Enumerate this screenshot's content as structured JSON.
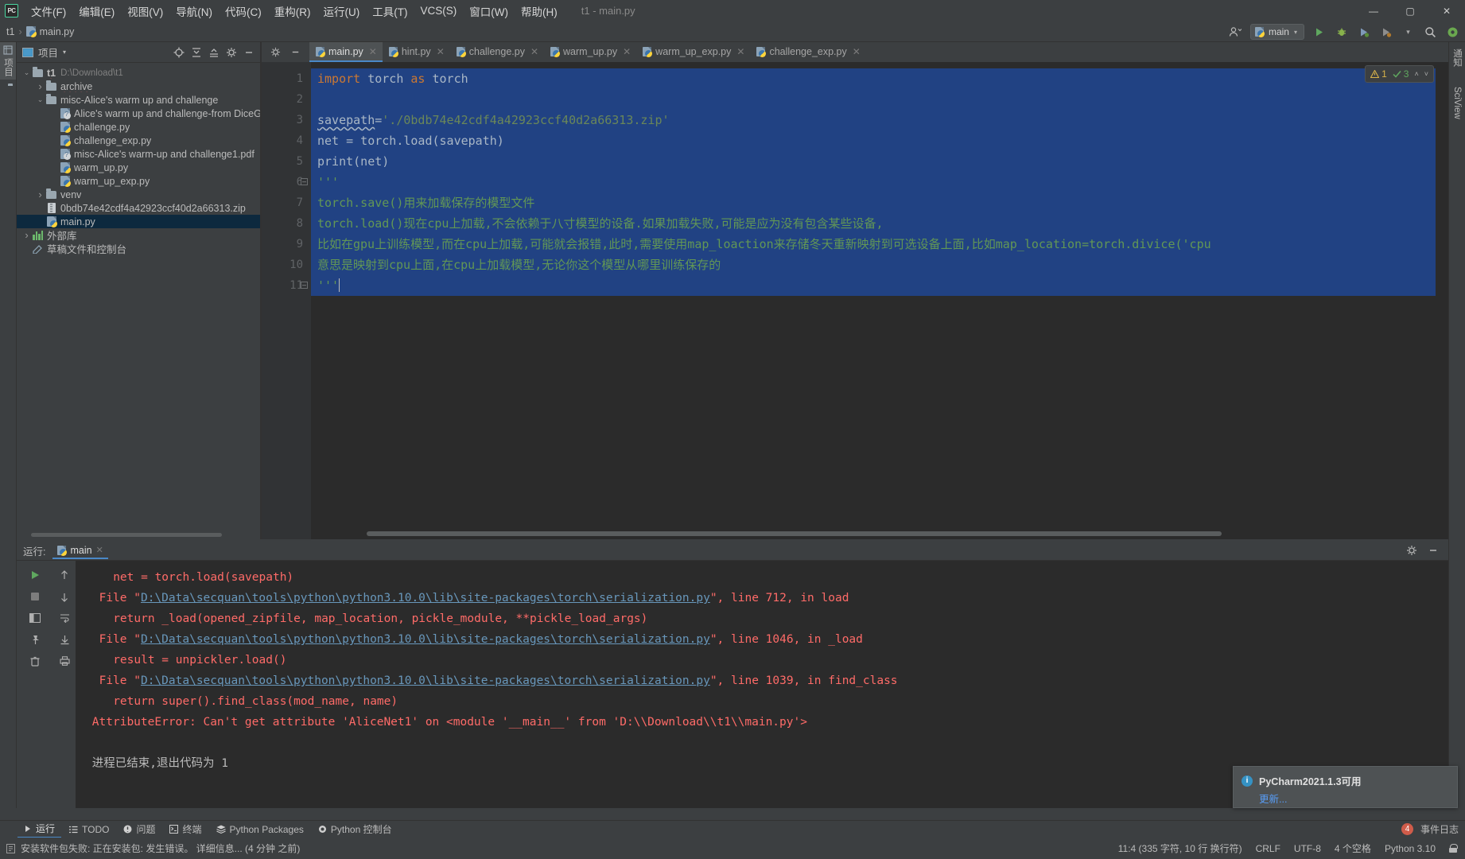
{
  "window": {
    "title": "t1 - main.py",
    "app_logo": "PC"
  },
  "menubar": {
    "items": [
      {
        "label": "文件(F)"
      },
      {
        "label": "编辑(E)"
      },
      {
        "label": "视图(V)"
      },
      {
        "label": "导航(N)"
      },
      {
        "label": "代码(C)"
      },
      {
        "label": "重构(R)"
      },
      {
        "label": "运行(U)"
      },
      {
        "label": "工具(T)"
      },
      {
        "label": "VCS(S)"
      },
      {
        "label": "窗口(W)"
      },
      {
        "label": "帮助(H)"
      }
    ],
    "controls": {
      "minimize": "—",
      "maximize": "▢",
      "close": "✕"
    }
  },
  "navbar": {
    "project": "t1",
    "file": "main.py",
    "run_config": "main",
    "run_icon": "run-icon",
    "debug_icon": "debug-icon",
    "coverage_icon": "coverage-icon",
    "profile_icon": "profile-icon",
    "more_icon": "chevron-down-icon",
    "search_icon": "search-icon",
    "account_icon": "account-icon",
    "settings_icon": "gear-icon"
  },
  "left_rail": {
    "items": [
      {
        "label": "项目",
        "name": "rail-project"
      },
      {
        "label": "",
        "name": "rail-structure"
      }
    ]
  },
  "right_rail": {
    "items": [
      {
        "label": "通知",
        "name": "rail-notifications"
      },
      {
        "label": "SciView",
        "name": "rail-sciview"
      }
    ]
  },
  "project_panel": {
    "title": "项目",
    "dropdown": "▾",
    "actions": [
      "locate-icon",
      "expand-all-icon",
      "collapse-all-icon",
      "gear-icon",
      "hide-icon"
    ],
    "tree": [
      {
        "indent": 0,
        "arrow": "v",
        "icon": "folder-icon",
        "label": "t1",
        "sub": "D:\\Download\\t1",
        "bold": true,
        "wavy": true,
        "selected": false
      },
      {
        "indent": 1,
        "arrow": ">",
        "icon": "folder-icon",
        "label": "archive",
        "sub": "",
        "wavy": true,
        "selected": false
      },
      {
        "indent": 1,
        "arrow": "v",
        "icon": "folder-icon",
        "label": "misc-Alice's warm up and challenge",
        "sub": "",
        "selected": false
      },
      {
        "indent": 2,
        "arrow": "",
        "icon": "file-unknown-icon",
        "label": "Alice's warm up and challenge-from DiceGuesser",
        "sub": "",
        "selected": false
      },
      {
        "indent": 2,
        "arrow": "",
        "icon": "python-file-icon",
        "label": "challenge.py",
        "sub": "",
        "selected": false
      },
      {
        "indent": 2,
        "arrow": "",
        "icon": "python-file-icon",
        "label": "challenge_exp.py",
        "sub": "",
        "selected": false
      },
      {
        "indent": 2,
        "arrow": "",
        "icon": "file-unknown-icon",
        "label": "misc-Alice's warm-up and challenge1.pdf",
        "sub": "",
        "selected": false
      },
      {
        "indent": 2,
        "arrow": "",
        "icon": "python-file-icon",
        "label": "warm_up.py",
        "sub": "",
        "selected": false
      },
      {
        "indent": 2,
        "arrow": "",
        "icon": "python-file-icon",
        "label": "warm_up_exp.py",
        "sub": "",
        "selected": false
      },
      {
        "indent": 1,
        "arrow": ">",
        "icon": "folder-icon",
        "label": "venv",
        "sub": "",
        "selected": false
      },
      {
        "indent": 1,
        "arrow": "",
        "icon": "zip-icon",
        "label": "0bdb74e42cdf4a42923ccf40d2a66313.zip",
        "sub": "",
        "selected": false
      },
      {
        "indent": 1,
        "arrow": "",
        "icon": "python-file-icon",
        "label": "main.py",
        "sub": "",
        "selected": true
      },
      {
        "indent": 0,
        "arrow": ">",
        "icon": "library-icon",
        "label": "外部库",
        "sub": "",
        "selected": false
      },
      {
        "indent": 0,
        "arrow": "",
        "icon": "scratch-icon",
        "label": "草稿文件和控制台",
        "sub": "",
        "selected": false
      }
    ]
  },
  "editor": {
    "tools": [
      "gear-icon",
      "hide-icon"
    ],
    "tabs": [
      {
        "label": "main.py",
        "active": true
      },
      {
        "label": "hint.py",
        "active": false
      },
      {
        "label": "challenge.py",
        "active": false
      },
      {
        "label": "warm_up.py",
        "active": false
      },
      {
        "label": "warm_up_exp.py",
        "active": false
      },
      {
        "label": "challenge_exp.py",
        "active": false
      }
    ],
    "inspection": {
      "warning_count": "1",
      "ok_count": "3",
      "up_icon": "chevron-up-icon",
      "down_icon": "chevron-down-icon"
    },
    "line_numbers": [
      "1",
      "2",
      "3",
      "4",
      "5",
      "6",
      "7",
      "8",
      "9",
      "10",
      "11"
    ],
    "code_lines": [
      {
        "n": 1,
        "selected": true,
        "tokens": [
          {
            "t": "import",
            "c": "kw"
          },
          {
            "t": " torch ",
            "c": "id"
          },
          {
            "t": "as",
            "c": "kw"
          },
          {
            "t": " torch",
            "c": "id"
          }
        ]
      },
      {
        "n": 2,
        "selected": true,
        "tokens": []
      },
      {
        "n": 3,
        "selected": true,
        "tokens": [
          {
            "t": "savepath",
            "c": "id err-u"
          },
          {
            "t": "=",
            "c": "id"
          },
          {
            "t": "'./0bdb74e42cdf4a42923ccf40d2a66313.zip'",
            "c": "str"
          }
        ]
      },
      {
        "n": 4,
        "selected": true,
        "tokens": [
          {
            "t": "net = torch.load(savepath)",
            "c": "id"
          }
        ]
      },
      {
        "n": 5,
        "selected": true,
        "tokens": [
          {
            "t": "print(net)",
            "c": "id"
          }
        ]
      },
      {
        "n": 6,
        "selected": true,
        "tokens": [
          {
            "t": "'''",
            "c": "cmt"
          }
        ]
      },
      {
        "n": 7,
        "selected": true,
        "tokens": [
          {
            "t": "torch.save()用来加载保存的模型文件",
            "c": "cmt"
          }
        ]
      },
      {
        "n": 8,
        "selected": true,
        "tokens": [
          {
            "t": "torch.load()现在cpu上加载,不会依赖于八寸模型的设备.如果加载失败,可能是应为没有包含某些设备,",
            "c": "cmt"
          }
        ]
      },
      {
        "n": 9,
        "selected": true,
        "tokens": [
          {
            "t": "比如在gpu上训练模型,而在cpu上加载,可能就会报错,此时,需要使用map_loaction来存储冬天重新映射到可选设备上面,比如map_location=torch.divice('cpu",
            "c": "cmt"
          }
        ]
      },
      {
        "n": 10,
        "selected": true,
        "tokens": [
          {
            "t": "意思是映射到cpu上面,在cpu上加载模型,无论你这个模型从哪里训练保存的",
            "c": "cmt"
          }
        ]
      },
      {
        "n": 11,
        "selected": true,
        "tokens": [
          {
            "t": "'''",
            "c": "cmt"
          }
        ]
      }
    ],
    "fold_lines": [
      6,
      11
    ]
  },
  "run_panel": {
    "label": "运行:",
    "tab": "main",
    "tab_close": "✕",
    "header_actions": [
      "gear-icon",
      "hide-icon"
    ],
    "left_actions": [
      "rerun-icon",
      "stop-icon",
      "layout-icon",
      "pin-icon",
      "trash-icon"
    ],
    "mid_actions": [
      "scroll-up-icon",
      "scroll-down-icon",
      "soft-wrap-icon",
      "scroll-to-end-icon",
      "print-icon"
    ],
    "console_lines": [
      {
        "indent": 4,
        "parts": [
          {
            "t": "net = torch.load(savepath)",
            "c": "cerr"
          }
        ]
      },
      {
        "indent": 2,
        "parts": [
          {
            "t": "File \"",
            "c": "cerr"
          },
          {
            "t": "D:\\Data\\secquan\\tools\\python\\python3.10.0\\lib\\site-packages\\torch\\serialization.py",
            "c": "clink"
          },
          {
            "t": "\", line 712, in load",
            "c": "cerr"
          }
        ]
      },
      {
        "indent": 4,
        "parts": [
          {
            "t": "return _load(opened_zipfile, map_location, pickle_module, **pickle_load_args)",
            "c": "cerr"
          }
        ]
      },
      {
        "indent": 2,
        "parts": [
          {
            "t": "File \"",
            "c": "cerr"
          },
          {
            "t": "D:\\Data\\secquan\\tools\\python\\python3.10.0\\lib\\site-packages\\torch\\serialization.py",
            "c": "clink"
          },
          {
            "t": "\", line 1046, in _load",
            "c": "cerr"
          }
        ]
      },
      {
        "indent": 4,
        "parts": [
          {
            "t": "result = unpickler.load()",
            "c": "cerr"
          }
        ]
      },
      {
        "indent": 2,
        "parts": [
          {
            "t": "File \"",
            "c": "cerr"
          },
          {
            "t": "D:\\Data\\secquan\\tools\\python\\python3.10.0\\lib\\site-packages\\torch\\serialization.py",
            "c": "clink"
          },
          {
            "t": "\", line 1039, in find_class",
            "c": "cerr"
          }
        ]
      },
      {
        "indent": 4,
        "parts": [
          {
            "t": "return super().find_class(mod_name, name)",
            "c": "cerr"
          }
        ]
      },
      {
        "indent": 1,
        "parts": [
          {
            "t": "AttributeError: Can't get attribute 'AliceNet1' on <module '__main__' from 'D:\\\\Download\\\\t1\\\\main.py'>",
            "c": "cerr"
          }
        ]
      },
      {
        "indent": 0,
        "parts": []
      },
      {
        "indent": 1,
        "parts": [
          {
            "t": "进程已结束,退出代码为 1",
            "c": "cout"
          }
        ]
      }
    ]
  },
  "notification": {
    "icon": "info-icon",
    "title": "PyCharm2021.1.3可用",
    "link": "更新..."
  },
  "bottom_bar": {
    "items": [
      {
        "label": "运行",
        "icon": "run-icon",
        "active": true
      },
      {
        "label": "TODO",
        "icon": "todo-icon",
        "active": false
      },
      {
        "label": "问题",
        "icon": "problems-icon",
        "active": false
      },
      {
        "label": "终端",
        "icon": "terminal-icon",
        "active": false
      },
      {
        "label": "Python Packages",
        "icon": "packages-icon",
        "active": false
      },
      {
        "label": "Python 控制台",
        "icon": "python-console-icon",
        "active": false
      }
    ],
    "event_badge": "4",
    "event_label": "事件日志"
  },
  "status_bar": {
    "message_icon": "message-icon",
    "message": "安装软件包失败: 正在安装包: 发生错误。 详细信息... (4 分钟 之前)",
    "caret": "11:4 (335 字符, 10 行 换行符)",
    "line_sep": "CRLF",
    "encoding": "UTF-8",
    "indent": "4 个空格",
    "interpreter": "Python 3.10",
    "lock_icon": "lock-icon"
  },
  "colors": {
    "accent_blue": "#4a88c7",
    "selection_blue": "#214283",
    "editor_bg": "#2b2b2b",
    "panel_bg": "#3c3f41",
    "error_red": "#ff6b68",
    "link_blue": "#6897bb",
    "comment_green": "#629755",
    "string_green": "#6a8759",
    "keyword_orange": "#cc7832"
  }
}
